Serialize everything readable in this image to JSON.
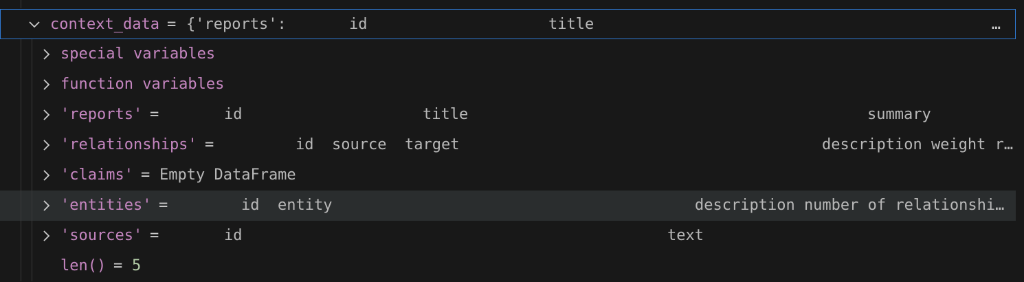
{
  "rows": {
    "context_data": {
      "name": "context_data",
      "eq": "=",
      "value_prefix": "{'reports':",
      "col_id": "id",
      "col_title": "title",
      "ellipsis": "…"
    },
    "special": {
      "name": "special variables"
    },
    "function": {
      "name": "function variables"
    },
    "reports": {
      "name": "'reports'",
      "eq": "=",
      "col_id": "id",
      "col_title": "title",
      "col_summary": "summary"
    },
    "relationships": {
      "name": "'relationships'",
      "eq": "=",
      "col_id": "id",
      "col_source": "source",
      "col_target": "target",
      "col_rest": "description weight r…"
    },
    "claims": {
      "name": "'claims'",
      "eq": "=",
      "value": "Empty DataFrame"
    },
    "entities": {
      "name": "'entities'",
      "eq": "=",
      "col_id": "id",
      "col_entity": "entity",
      "col_rest": "description number of relationshi…"
    },
    "sources": {
      "name": "'sources'",
      "eq": "=",
      "col_id": "id",
      "col_text": "text"
    },
    "len": {
      "name": "len()",
      "eq": "=",
      "value": "5"
    }
  }
}
